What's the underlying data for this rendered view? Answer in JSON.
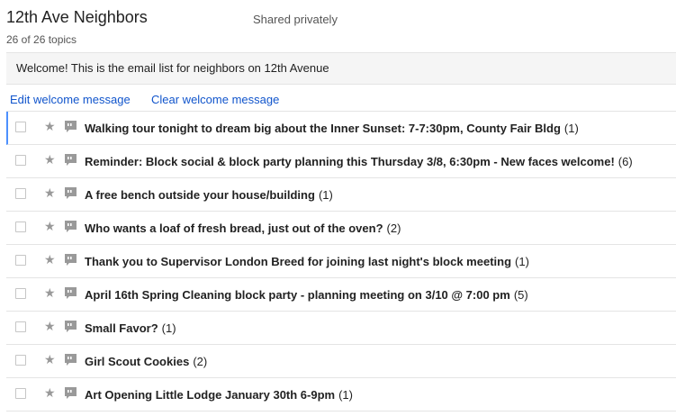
{
  "header": {
    "group_title": "12th Ave Neighbors",
    "topic_count": "26 of 26 topics",
    "sharing_status": "Shared privately"
  },
  "welcome": {
    "message": "Welcome! This is the email list for neighbors on 12th Avenue",
    "edit_label": "Edit welcome message",
    "clear_label": "Clear welcome message"
  },
  "icons": {
    "star": "star-icon",
    "topic": "chat-bubble-icon"
  },
  "colors": {
    "link": "#1155cc",
    "focus_bar": "#4d90fe",
    "chat_icon": "#999999"
  },
  "topics": [
    {
      "title": "Walking tour tonight to dream big about the Inner Sunset: 7-7:30pm, County Fair Bldg",
      "count": "(1)"
    },
    {
      "title": "Reminder: Block social & block party planning this Thursday 3/8, 6:30pm - New faces welcome!",
      "count": "(6)"
    },
    {
      "title": "A free bench outside your house/building",
      "count": "(1)"
    },
    {
      "title": "Who wants a loaf of fresh bread, just out of the oven?",
      "count": "(2)"
    },
    {
      "title": "Thank you to Supervisor London Breed for joining last night's block meeting",
      "count": "(1)"
    },
    {
      "title": "April 16th Spring Cleaning block party - planning meeting on 3/10 @ 7:00 pm",
      "count": "(5)"
    },
    {
      "title": "Small Favor?",
      "count": "(1)"
    },
    {
      "title": "Girl Scout Cookies",
      "count": "(2)"
    },
    {
      "title": "Art Opening Little Lodge January 30th 6-9pm",
      "count": "(1)"
    }
  ]
}
